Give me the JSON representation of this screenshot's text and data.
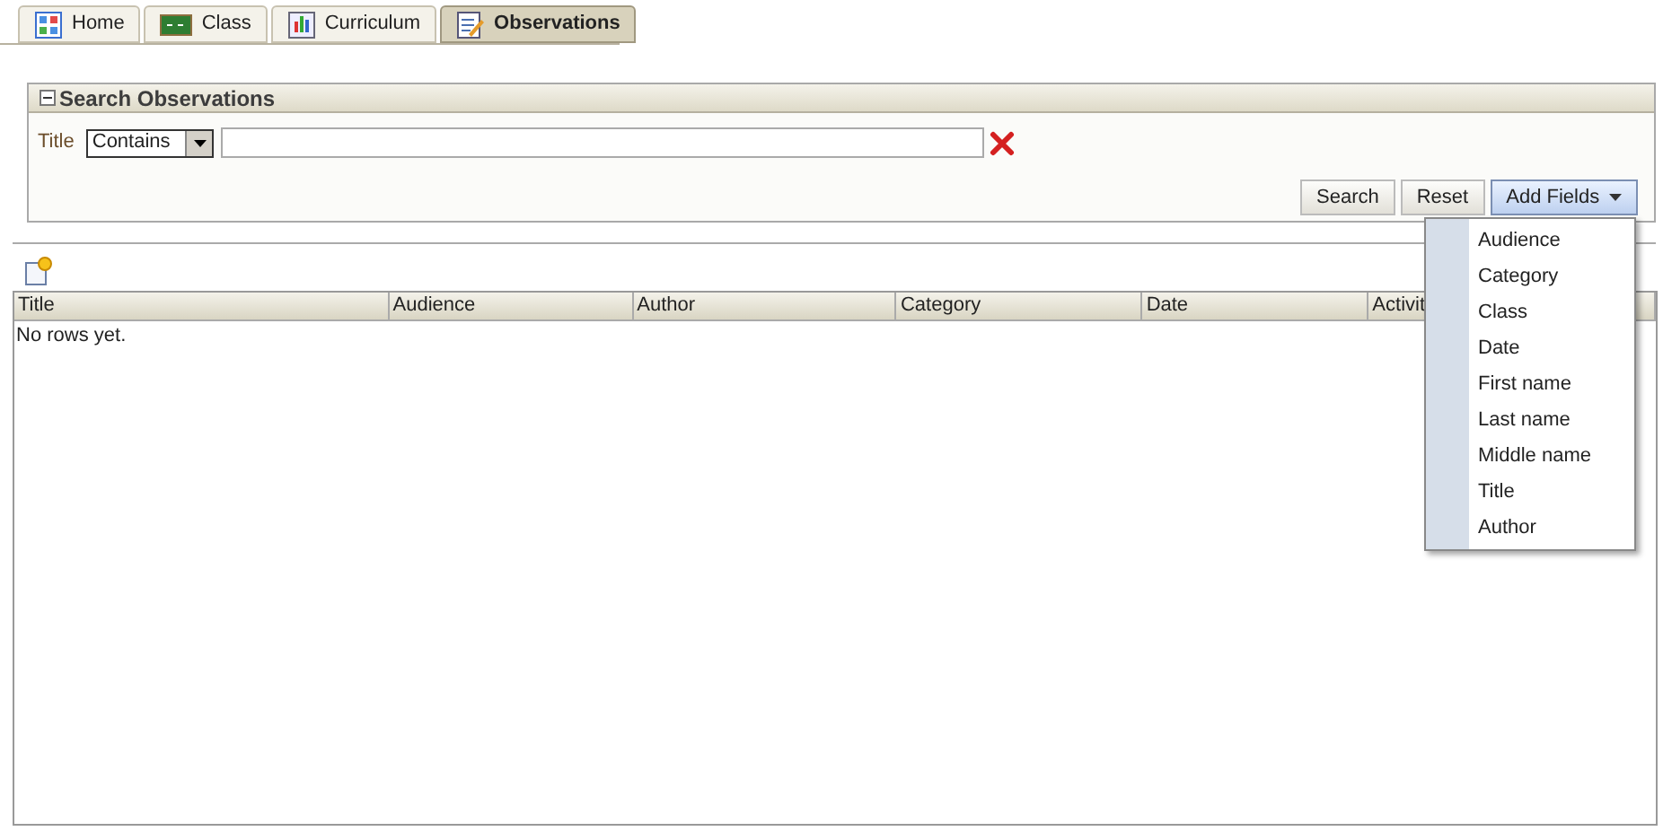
{
  "tabs": [
    {
      "label": "Home",
      "kind": "home",
      "selected": false
    },
    {
      "label": "Class",
      "kind": "class",
      "selected": false
    },
    {
      "label": "Curriculum",
      "kind": "curriculum",
      "selected": false
    },
    {
      "label": "Observations",
      "kind": "observations",
      "selected": true
    }
  ],
  "search_panel": {
    "title": "Search Observations",
    "expanded": true,
    "field_label": "Title",
    "operator": "Contains",
    "buttons": [
      "Search",
      "Reset"
    ],
    "add_fields": {
      "label": "Add Fields",
      "expanded": true,
      "items": [
        "Audience",
        "Category",
        "Class",
        "Date",
        "First name",
        "Last name",
        "Middle name",
        "Title",
        "Author"
      ]
    }
  },
  "table": {
    "columns": [
      "Title",
      "Audience",
      "Author",
      "Category",
      "Date",
      "Activit"
    ],
    "empty_message": "No rows yet."
  }
}
